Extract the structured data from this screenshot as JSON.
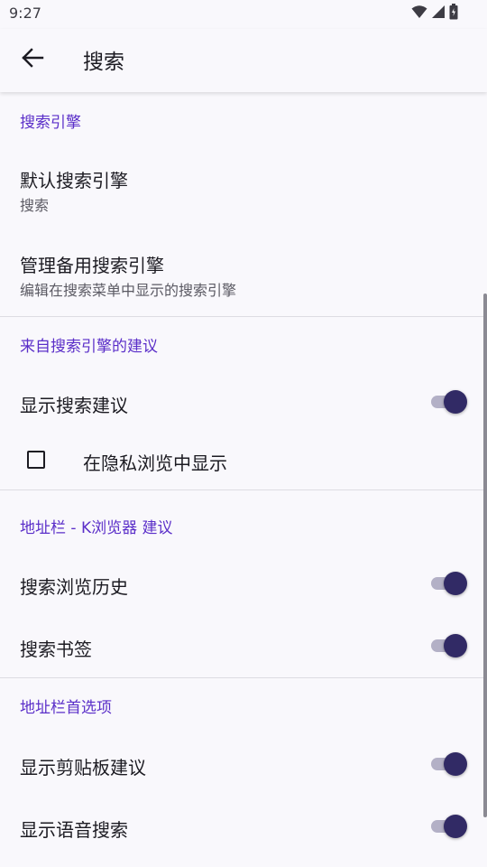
{
  "status_bar": {
    "time": "9:27",
    "icons": [
      "wifi-icon",
      "signal-icon",
      "battery-icon"
    ]
  },
  "app_bar": {
    "back_icon": "arrow-left-icon",
    "title": "搜索"
  },
  "colors": {
    "accent": "#5b2fc9",
    "switch_thumb": "#312a65",
    "switch_track": "#b3b0c6",
    "background": "#f9f8fc"
  },
  "sections": [
    {
      "header": "搜索引擎",
      "items": [
        {
          "type": "text",
          "title": "默认搜索引擎",
          "summary": "搜索"
        },
        {
          "type": "text",
          "title": "管理备用搜索引擎",
          "summary": "编辑在搜索菜单中显示的搜索引擎"
        }
      ]
    },
    {
      "header": "来自搜索引擎的建议",
      "items": [
        {
          "type": "switch",
          "title": "显示搜索建议",
          "checked": true
        },
        {
          "type": "checkbox",
          "title": "在隐私浏览中显示",
          "checked": false
        }
      ]
    },
    {
      "header": "地址栏 - K浏览器 建议",
      "items": [
        {
          "type": "switch",
          "title": "搜索浏览历史",
          "checked": true
        },
        {
          "type": "switch",
          "title": "搜索书签",
          "checked": true
        }
      ]
    },
    {
      "header": "地址栏首选项",
      "items": [
        {
          "type": "switch",
          "title": "显示剪贴板建议",
          "checked": true
        },
        {
          "type": "switch",
          "title": "显示语音搜索",
          "checked": true
        }
      ]
    }
  ]
}
